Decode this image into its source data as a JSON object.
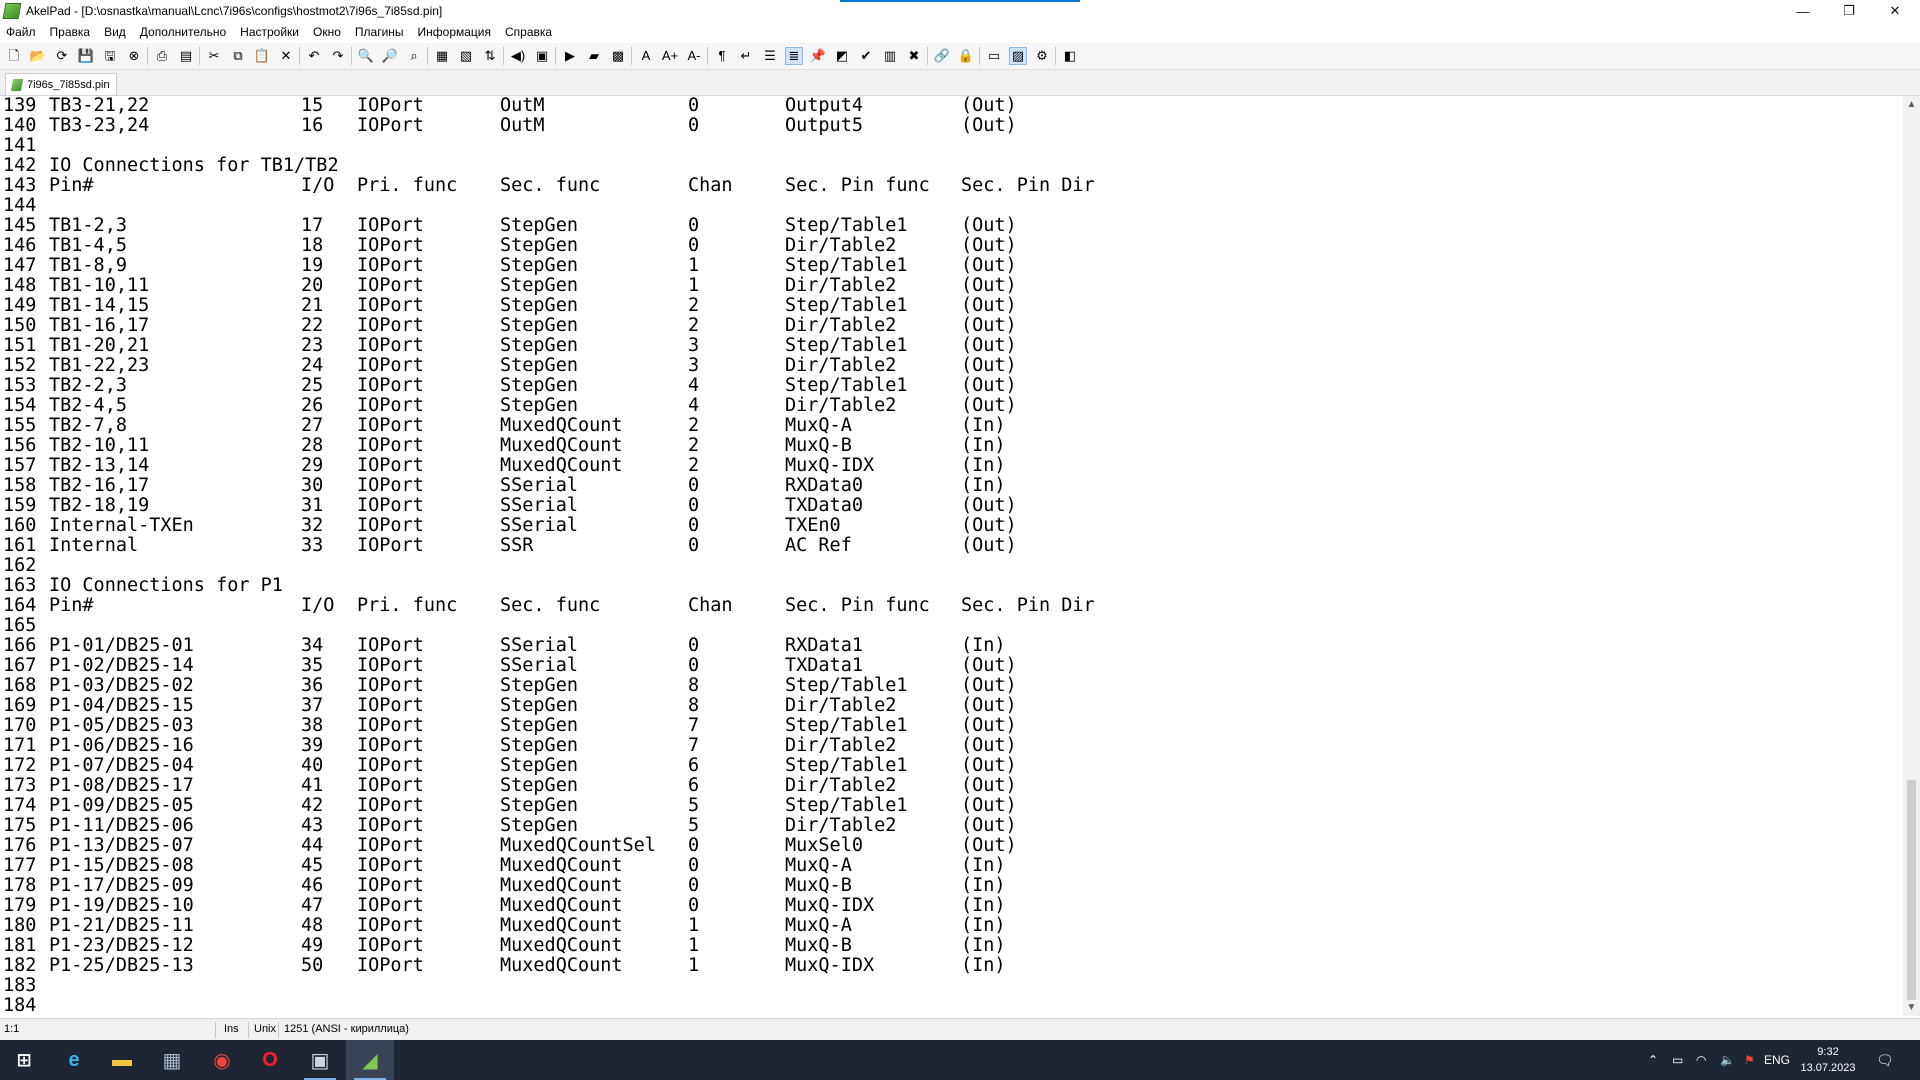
{
  "window": {
    "title": "AkelPad - [D:\\osnastka\\manual\\Lcnc\\7i96s\\configs\\hostmot2\\7i96s_7i85sd.pin]",
    "minimize": "—",
    "maximize": "❐",
    "close": "✕"
  },
  "menu": [
    "Файл",
    "Правка",
    "Вид",
    "Дополнительно",
    "Настройки",
    "Окно",
    "Плагины",
    "Информация",
    "Справка"
  ],
  "toolbar": [
    {
      "icon": "new-file-icon",
      "glyph": "🗋"
    },
    {
      "icon": "open-file-icon",
      "glyph": "📂"
    },
    {
      "icon": "reopen-icon",
      "glyph": "⟳"
    },
    {
      "icon": "save-icon",
      "glyph": "💾"
    },
    {
      "icon": "save-all-icon",
      "glyph": "🖫"
    },
    {
      "icon": "close-file-icon",
      "glyph": "⊗"
    },
    {
      "icon": "print-icon",
      "glyph": "⎙"
    },
    {
      "icon": "page-setup-icon",
      "glyph": "▤"
    },
    {
      "icon": "cut-icon",
      "glyph": "✂"
    },
    {
      "icon": "copy-icon",
      "glyph": "⧉"
    },
    {
      "icon": "paste-icon",
      "glyph": "📋"
    },
    {
      "icon": "delete-icon",
      "glyph": "✕"
    },
    {
      "icon": "undo-icon",
      "glyph": "↶"
    },
    {
      "icon": "redo-icon",
      "glyph": "↷"
    },
    {
      "icon": "find-icon",
      "glyph": "🔍"
    },
    {
      "icon": "find-next-icon",
      "glyph": "🔎"
    },
    {
      "icon": "replace-icon",
      "glyph": "⌕"
    },
    {
      "icon": "column-select-icon",
      "glyph": "▦"
    },
    {
      "icon": "insert-date-icon",
      "glyph": "▧"
    },
    {
      "icon": "recode-icon",
      "glyph": "⇅"
    },
    {
      "icon": "audio-icon",
      "glyph": "◀)"
    },
    {
      "icon": "macro-icon",
      "glyph": "▣"
    },
    {
      "icon": "run-icon",
      "glyph": "▶"
    },
    {
      "icon": "export-icon",
      "glyph": "▰"
    },
    {
      "icon": "image-icon",
      "glyph": "▩"
    },
    {
      "icon": "font-icon",
      "glyph": "A"
    },
    {
      "icon": "font-bigger-icon",
      "glyph": "A+"
    },
    {
      "icon": "font-smaller-icon",
      "glyph": "A-"
    },
    {
      "icon": "show-whitespace-icon",
      "glyph": "¶"
    },
    {
      "icon": "word-wrap-icon",
      "glyph": "↵"
    },
    {
      "icon": "sidebar-icon",
      "glyph": "☰"
    },
    {
      "icon": "line-numbers-icon",
      "glyph": "≣"
    },
    {
      "icon": "pin-icon",
      "glyph": "📌"
    },
    {
      "icon": "window-icon",
      "glyph": "◩"
    },
    {
      "icon": "spellcheck-icon",
      "glyph": "✔"
    },
    {
      "icon": "table-icon",
      "glyph": "▥"
    },
    {
      "icon": "tools-icon",
      "glyph": "✖"
    },
    {
      "icon": "link-icon",
      "glyph": "🔗"
    },
    {
      "icon": "lock-icon",
      "glyph": "🔒"
    },
    {
      "icon": "panel-icon",
      "glyph": "▭"
    },
    {
      "icon": "scripts-icon",
      "glyph": "▨"
    },
    {
      "icon": "settings-icon",
      "glyph": "⚙"
    },
    {
      "icon": "plugin-icon",
      "glyph": "◧"
    }
  ],
  "tab": {
    "label": "7i96s_7i85sd.pin"
  },
  "editor": {
    "lines": [
      {
        "n": "139",
        "c": [
          "TB3-21,22",
          "15",
          "IOPort",
          "OutM",
          "0",
          "Output4",
          "(Out)"
        ]
      },
      {
        "n": "140",
        "c": [
          "TB3-23,24",
          "16",
          "IOPort",
          "OutM",
          "0",
          "Output5",
          "(Out)"
        ]
      },
      {
        "n": "141",
        "c": []
      },
      {
        "n": "142",
        "c": [
          "IO Connections for TB1/TB2"
        ]
      },
      {
        "n": "143",
        "c": [
          "Pin#",
          "I/O",
          "Pri. func",
          "Sec. func",
          "Chan",
          "Sec. Pin func",
          "Sec. Pin Dir"
        ]
      },
      {
        "n": "144",
        "c": []
      },
      {
        "n": "145",
        "c": [
          "TB1-2,3",
          "17",
          "IOPort",
          "StepGen",
          "0",
          "Step/Table1",
          "(Out)"
        ]
      },
      {
        "n": "146",
        "c": [
          "TB1-4,5",
          "18",
          "IOPort",
          "StepGen",
          "0",
          "Dir/Table2",
          "(Out)"
        ]
      },
      {
        "n": "147",
        "c": [
          "TB1-8,9",
          "19",
          "IOPort",
          "StepGen",
          "1",
          "Step/Table1",
          "(Out)"
        ]
      },
      {
        "n": "148",
        "c": [
          "TB1-10,11",
          "20",
          "IOPort",
          "StepGen",
          "1",
          "Dir/Table2",
          "(Out)"
        ]
      },
      {
        "n": "149",
        "c": [
          "TB1-14,15",
          "21",
          "IOPort",
          "StepGen",
          "2",
          "Step/Table1",
          "(Out)"
        ]
      },
      {
        "n": "150",
        "c": [
          "TB1-16,17",
          "22",
          "IOPort",
          "StepGen",
          "2",
          "Dir/Table2",
          "(Out)"
        ]
      },
      {
        "n": "151",
        "c": [
          "TB1-20,21",
          "23",
          "IOPort",
          "StepGen",
          "3",
          "Step/Table1",
          "(Out)"
        ]
      },
      {
        "n": "152",
        "c": [
          "TB1-22,23",
          "24",
          "IOPort",
          "StepGen",
          "3",
          "Dir/Table2",
          "(Out)"
        ]
      },
      {
        "n": "153",
        "c": [
          "TB2-2,3",
          "25",
          "IOPort",
          "StepGen",
          "4",
          "Step/Table1",
          "(Out)"
        ]
      },
      {
        "n": "154",
        "c": [
          "TB2-4,5",
          "26",
          "IOPort",
          "StepGen",
          "4",
          "Dir/Table2",
          "(Out)"
        ]
      },
      {
        "n": "155",
        "c": [
          "TB2-7,8",
          "27",
          "IOPort",
          "MuxedQCount",
          "2",
          "MuxQ-A",
          "(In)"
        ]
      },
      {
        "n": "156",
        "c": [
          "TB2-10,11",
          "28",
          "IOPort",
          "MuxedQCount",
          "2",
          "MuxQ-B",
          "(In)"
        ]
      },
      {
        "n": "157",
        "c": [
          "TB2-13,14",
          "29",
          "IOPort",
          "MuxedQCount",
          "2",
          "MuxQ-IDX",
          "(In)"
        ]
      },
      {
        "n": "158",
        "c": [
          "TB2-16,17",
          "30",
          "IOPort",
          "SSerial",
          "0",
          "RXData0",
          "(In)"
        ]
      },
      {
        "n": "159",
        "c": [
          "TB2-18,19",
          "31",
          "IOPort",
          "SSerial",
          "0",
          "TXData0",
          "(Out)"
        ]
      },
      {
        "n": "160",
        "c": [
          "Internal-TXEn",
          "32",
          "IOPort",
          "SSerial",
          "0",
          "TXEn0",
          "(Out)"
        ]
      },
      {
        "n": "161",
        "c": [
          "Internal",
          "33",
          "IOPort",
          "SSR",
          "0",
          "AC Ref",
          "(Out)"
        ]
      },
      {
        "n": "162",
        "c": []
      },
      {
        "n": "163",
        "c": [
          "IO Connections for P1"
        ]
      },
      {
        "n": "164",
        "c": [
          "Pin#",
          "I/O",
          "Pri. func",
          "Sec. func",
          "Chan",
          "Sec. Pin func",
          "Sec. Pin Dir"
        ]
      },
      {
        "n": "165",
        "c": []
      },
      {
        "n": "166",
        "c": [
          "P1-01/DB25-01",
          "34",
          "IOPort",
          "SSerial",
          "0",
          "RXData1",
          "(In)"
        ]
      },
      {
        "n": "167",
        "c": [
          "P1-02/DB25-14",
          "35",
          "IOPort",
          "SSerial",
          "0",
          "TXData1",
          "(Out)"
        ]
      },
      {
        "n": "168",
        "c": [
          "P1-03/DB25-02",
          "36",
          "IOPort",
          "StepGen",
          "8",
          "Step/Table1",
          "(Out)"
        ]
      },
      {
        "n": "169",
        "c": [
          "P1-04/DB25-15",
          "37",
          "IOPort",
          "StepGen",
          "8",
          "Dir/Table2",
          "(Out)"
        ]
      },
      {
        "n": "170",
        "c": [
          "P1-05/DB25-03",
          "38",
          "IOPort",
          "StepGen",
          "7",
          "Step/Table1",
          "(Out)"
        ]
      },
      {
        "n": "171",
        "c": [
          "P1-06/DB25-16",
          "39",
          "IOPort",
          "StepGen",
          "7",
          "Dir/Table2",
          "(Out)"
        ]
      },
      {
        "n": "172",
        "c": [
          "P1-07/DB25-04",
          "40",
          "IOPort",
          "StepGen",
          "6",
          "Step/Table1",
          "(Out)"
        ]
      },
      {
        "n": "173",
        "c": [
          "P1-08/DB25-17",
          "41",
          "IOPort",
          "StepGen",
          "6",
          "Dir/Table2",
          "(Out)"
        ]
      },
      {
        "n": "174",
        "c": [
          "P1-09/DB25-05",
          "42",
          "IOPort",
          "StepGen",
          "5",
          "Step/Table1",
          "(Out)"
        ]
      },
      {
        "n": "175",
        "c": [
          "P1-11/DB25-06",
          "43",
          "IOPort",
          "StepGen",
          "5",
          "Dir/Table2",
          "(Out)"
        ]
      },
      {
        "n": "176",
        "c": [
          "P1-13/DB25-07",
          "44",
          "IOPort",
          "MuxedQCountSel",
          "0",
          "MuxSel0",
          "(Out)"
        ]
      },
      {
        "n": "177",
        "c": [
          "P1-15/DB25-08",
          "45",
          "IOPort",
          "MuxedQCount",
          "0",
          "MuxQ-A",
          "(In)"
        ]
      },
      {
        "n": "178",
        "c": [
          "P1-17/DB25-09",
          "46",
          "IOPort",
          "MuxedQCount",
          "0",
          "MuxQ-B",
          "(In)"
        ]
      },
      {
        "n": "179",
        "c": [
          "P1-19/DB25-10",
          "47",
          "IOPort",
          "MuxedQCount",
          "0",
          "MuxQ-IDX",
          "(In)"
        ]
      },
      {
        "n": "180",
        "c": [
          "P1-21/DB25-11",
          "48",
          "IOPort",
          "MuxedQCount",
          "1",
          "MuxQ-A",
          "(In)"
        ]
      },
      {
        "n": "181",
        "c": [
          "P1-23/DB25-12",
          "49",
          "IOPort",
          "MuxedQCount",
          "1",
          "MuxQ-B",
          "(In)"
        ]
      },
      {
        "n": "182",
        "c": [
          "P1-25/DB25-13",
          "50",
          "IOPort",
          "MuxedQCount",
          "1",
          "MuxQ-IDX",
          "(In)"
        ]
      },
      {
        "n": "183",
        "c": []
      },
      {
        "n": "184",
        "c": []
      }
    ]
  },
  "status": {
    "position": "1:1",
    "insert_mode": "Ins",
    "newline": "Unix",
    "encoding": "1251  (ANSI - кириллица)"
  },
  "taskbar": {
    "apps": [
      {
        "icon": "windows-start-icon",
        "glyph": "⊞",
        "color": "#ffffff"
      },
      {
        "icon": "edge-icon",
        "glyph": "e",
        "color": "#3db0e8"
      },
      {
        "icon": "file-explorer-icon",
        "glyph": "▬",
        "color": "#f4c542"
      },
      {
        "icon": "calculator-icon",
        "glyph": "▦",
        "color": "#a8b4c6"
      },
      {
        "icon": "chrome-icon",
        "glyph": "◉",
        "color": "#e8453c"
      },
      {
        "icon": "opera-icon",
        "glyph": "O",
        "color": "#ff1b2d"
      },
      {
        "icon": "remote-app-icon",
        "glyph": "▣",
        "color": "#cfd6e0"
      },
      {
        "icon": "akelpad-icon",
        "glyph": "◢",
        "color": "#7ec850"
      }
    ],
    "language": "ENG",
    "time": "9:32",
    "date": "13.07.2023"
  }
}
